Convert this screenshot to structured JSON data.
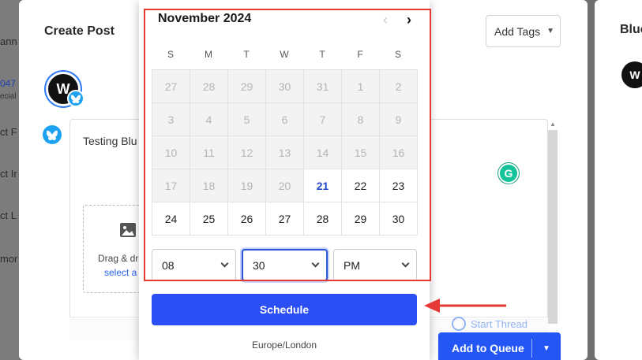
{
  "background_fragments": [
    "ann",
    "047",
    "ecial",
    "ct F",
    "ct Ir",
    "ct L",
    "mor"
  ],
  "modal": {
    "title": "Create Post",
    "add_tags_label": "Add Tags",
    "editor_text": "Testing Blu",
    "dropzone_text": "Drag & dro",
    "dropzone_link": "select a",
    "grammarly_letter": "G",
    "start_thread_label": "Start Thread",
    "add_to_queue_label": "Add to Queue"
  },
  "right_panel": {
    "title": "Blue"
  },
  "calendar": {
    "month_label": "November 2024",
    "weekdays": [
      "S",
      "M",
      "T",
      "W",
      "T",
      "F",
      "S"
    ],
    "rows": [
      [
        "27",
        "28",
        "29",
        "30",
        "31",
        "1",
        "2"
      ],
      [
        "3",
        "4",
        "5",
        "6",
        "7",
        "8",
        "9"
      ],
      [
        "10",
        "11",
        "12",
        "13",
        "14",
        "15",
        "16"
      ],
      [
        "17",
        "18",
        "19",
        "20",
        "21",
        "22",
        "23"
      ],
      [
        "24",
        "25",
        "26",
        "27",
        "28",
        "29",
        "30"
      ]
    ],
    "first_enabled_index": 25,
    "today": "21",
    "prev_icon": "chevron-left-icon",
    "next_icon": "chevron-right-icon"
  },
  "time": {
    "hour": "08",
    "minute": "30",
    "ampm": "PM"
  },
  "schedule_label": "Schedule",
  "timezone": "Europe/London",
  "colors": {
    "primary_button": "#2b4ff5",
    "highlight_border": "#e53935",
    "today": "#2446c9",
    "arrow": "#e53935"
  }
}
